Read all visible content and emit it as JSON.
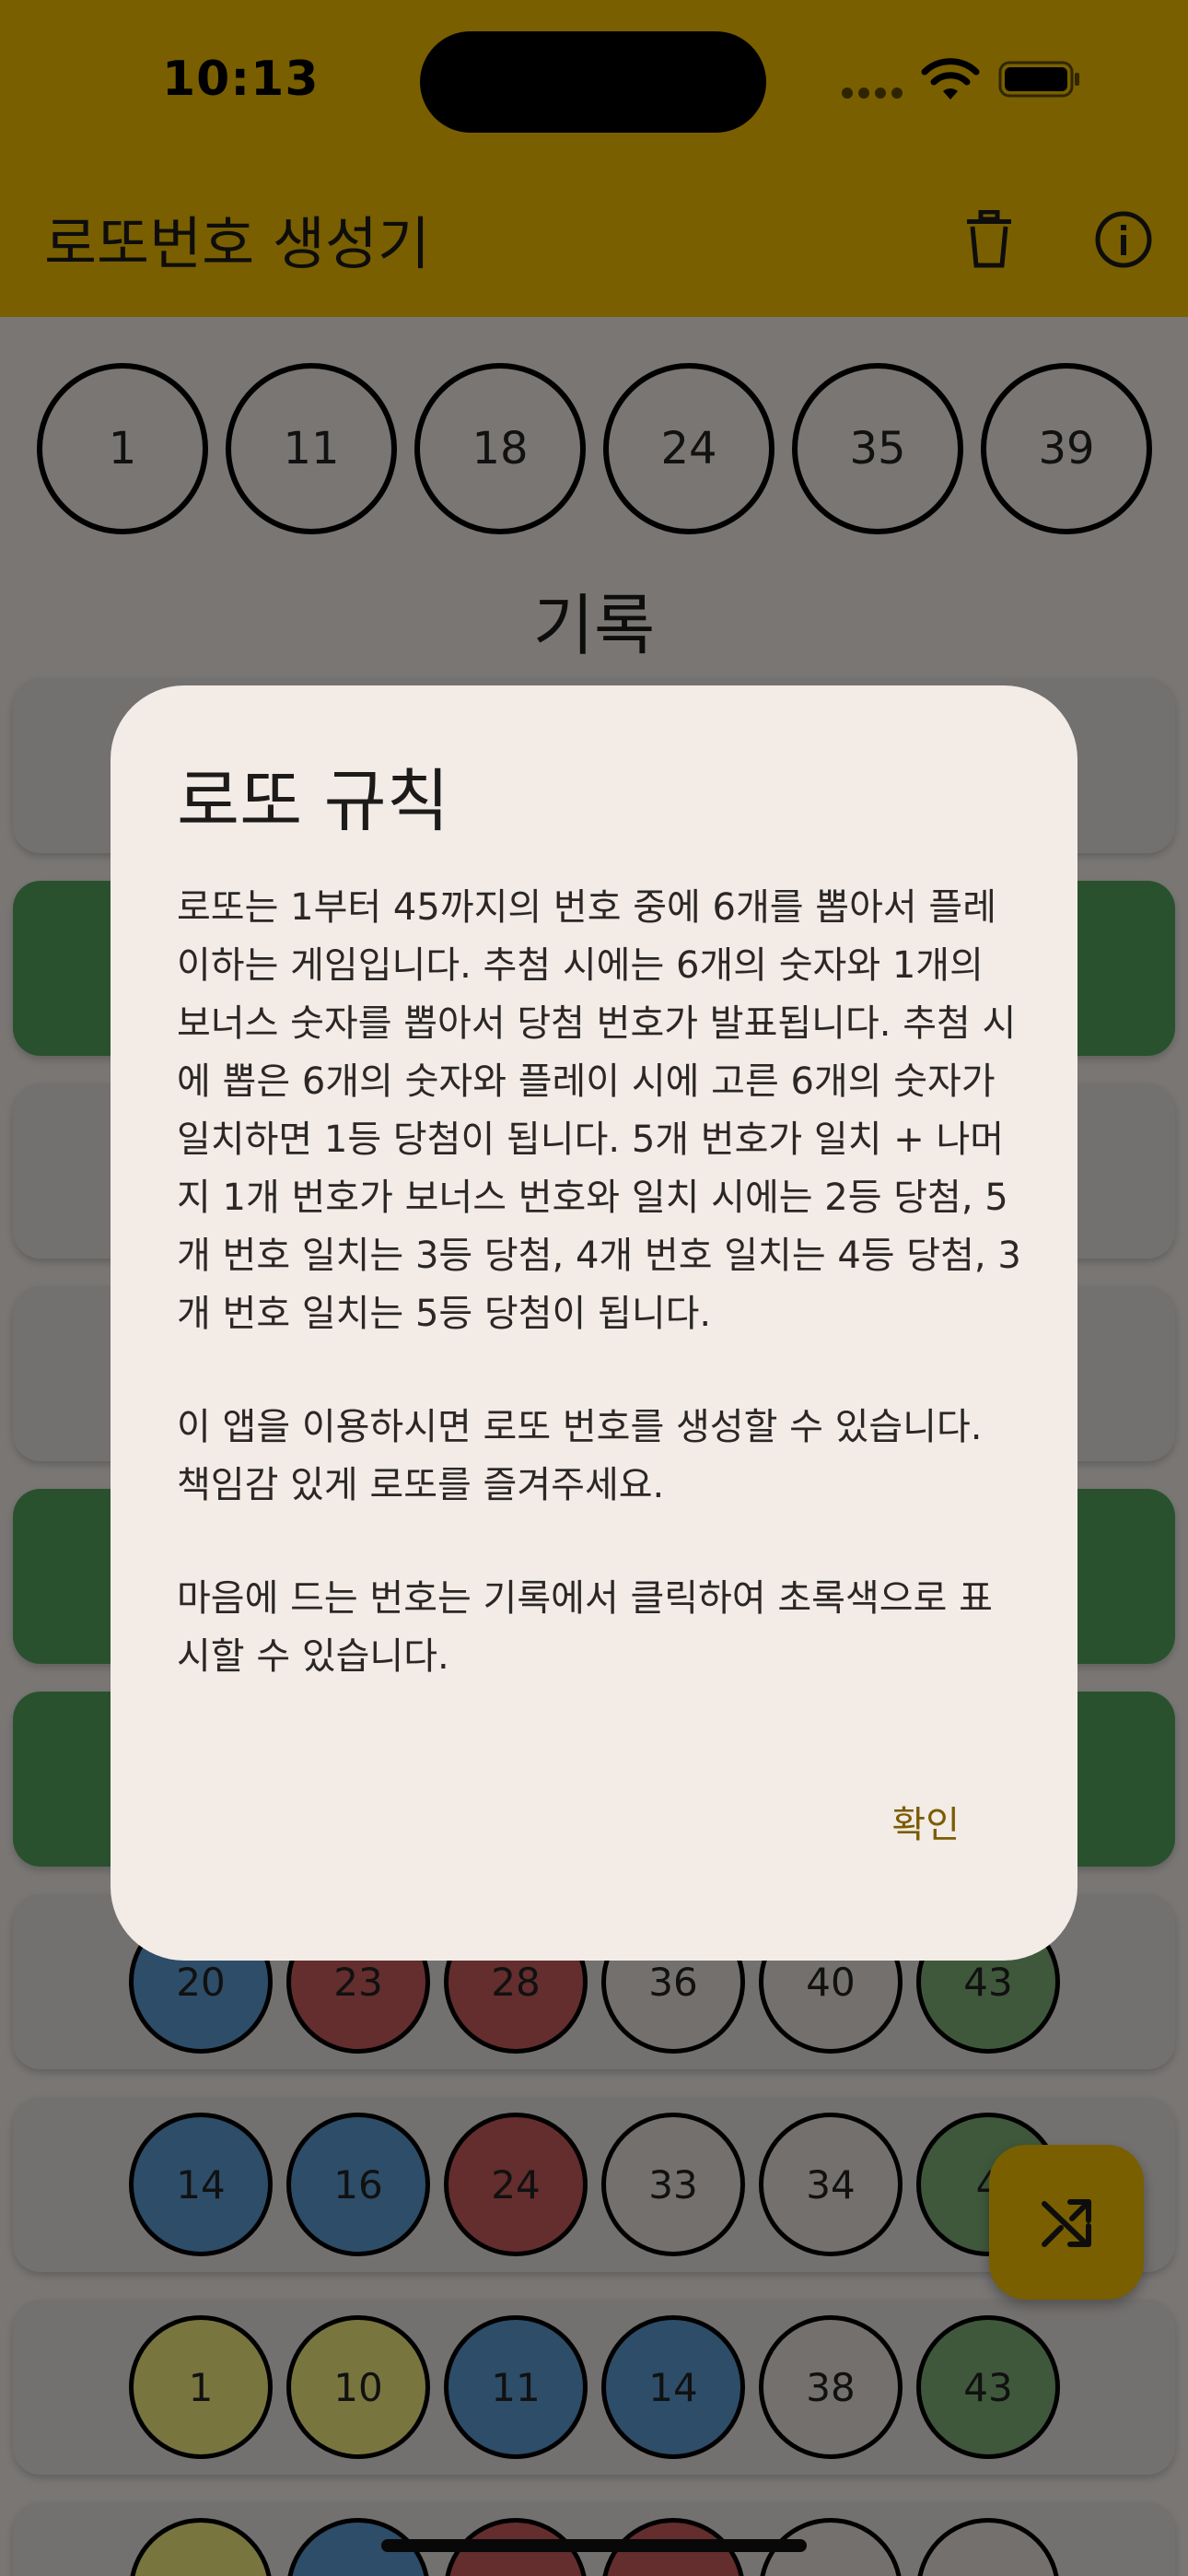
{
  "status_bar": {
    "time": "10:13"
  },
  "app_bar": {
    "title": "로또번호 생성기",
    "actions": [
      {
        "name": "delete",
        "icon": "trash-icon"
      },
      {
        "name": "info",
        "icon": "info-icon"
      }
    ]
  },
  "colors": {
    "app_bar": "#F2BF00",
    "fab": "#F2BF00",
    "favorite_card": "#55A35A",
    "ball_blue": "#5A9AD3",
    "ball_red": "#C85A5C",
    "ball_gray": "#E6E1DD",
    "ball_green": "#7EB178",
    "ball_yellow": "#F2EB7E",
    "confirm_text": "#7A5C00"
  },
  "current_numbers": [
    "1",
    "11",
    "18",
    "24",
    "35",
    "39"
  ],
  "history": {
    "title": "기록",
    "rows": [
      {
        "favorite": false,
        "balls": []
      },
      {
        "favorite": true,
        "balls": []
      },
      {
        "favorite": false,
        "balls": []
      },
      {
        "favorite": false,
        "balls": []
      },
      {
        "favorite": true,
        "balls": []
      },
      {
        "favorite": true,
        "balls": []
      },
      {
        "favorite": false,
        "balls": [
          {
            "n": "20",
            "c": "blue"
          },
          {
            "n": "23",
            "c": "red"
          },
          {
            "n": "28",
            "c": "red"
          },
          {
            "n": "36",
            "c": "gray"
          },
          {
            "n": "40",
            "c": "gray"
          },
          {
            "n": "43",
            "c": "green"
          }
        ]
      },
      {
        "favorite": false,
        "balls": [
          {
            "n": "14",
            "c": "blue"
          },
          {
            "n": "16",
            "c": "blue"
          },
          {
            "n": "24",
            "c": "red"
          },
          {
            "n": "33",
            "c": "gray"
          },
          {
            "n": "34",
            "c": "gray"
          },
          {
            "n": "4",
            "c": "green"
          }
        ]
      },
      {
        "favorite": false,
        "balls": [
          {
            "n": "1",
            "c": "yellow"
          },
          {
            "n": "10",
            "c": "yellow"
          },
          {
            "n": "11",
            "c": "blue"
          },
          {
            "n": "14",
            "c": "blue"
          },
          {
            "n": "38",
            "c": "gray"
          },
          {
            "n": "43",
            "c": "green"
          }
        ]
      },
      {
        "favorite": false,
        "balls": [
          {
            "n": "",
            "c": "yellow"
          },
          {
            "n": "",
            "c": "blue"
          },
          {
            "n": "",
            "c": "red"
          },
          {
            "n": "",
            "c": "red"
          },
          {
            "n": "",
            "c": "gray"
          },
          {
            "n": "",
            "c": "gray"
          }
        ]
      }
    ]
  },
  "fab": {
    "icon": "shuffle-icon"
  },
  "dialog": {
    "title": "로또 규칙",
    "paragraphs": [
      "로또는 1부터 45까지의 번호 중에 6개를 뽑아서 플레이하는 게임입니다. 추첨 시에는 6개의 숫자와 1개의 보너스 숫자를 뽑아서 당첨 번호가 발표됩니다. 추첨 시에 뽑은 6개의 숫자와 플레이 시에 고른 6개의 숫자가 일치하면 1등 당첨이 됩니다. 5개 번호가 일치 + 나머지 1개 번호가 보너스 번호와 일치 시에는 2등 당첨, 5개 번호 일치는 3등 당첨, 4개 번호 일치는 4등 당첨, 3개 번호 일치는 5등 당첨이 됩니다.",
      "이 앱을 이용하시면 로또 번호를 생성할 수 있습니다. 책임감 있게 로또를 즐겨주세요.",
      "마음에 드는 번호는 기록에서 클릭하여 초록색으로 표시할 수 있습니다."
    ],
    "confirm_label": "확인"
  }
}
